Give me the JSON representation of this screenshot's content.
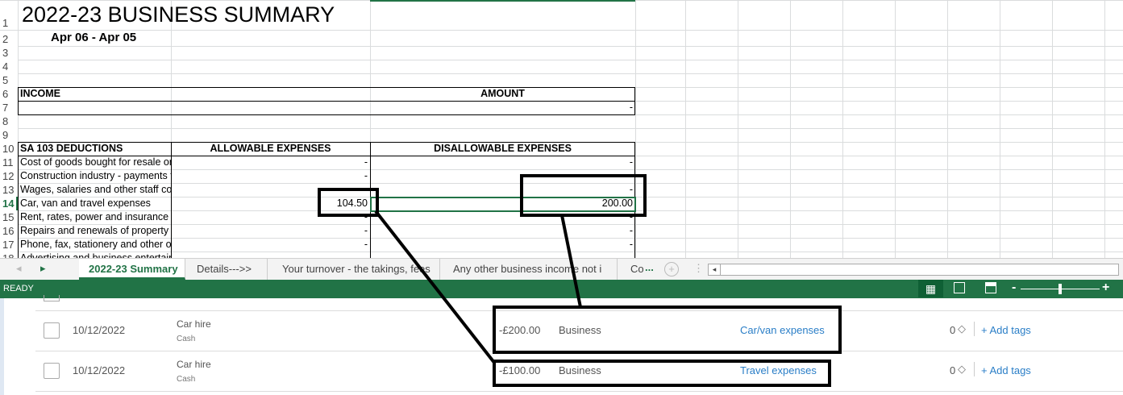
{
  "sheet": {
    "title": "2022-23 BUSINESS SUMMARY",
    "subtitle": "Apr 06 - Apr 05",
    "row_numbers": [
      "1",
      "2",
      "3",
      "4",
      "5",
      "6",
      "7",
      "8",
      "9",
      "10",
      "11",
      "12",
      "13",
      "14",
      "15",
      "16",
      "17",
      "18"
    ],
    "income_label": "INCOME",
    "amount_label": "AMOUNT",
    "row7_amount": "-",
    "deductions_label": "SA 103 DEDUCTIONS",
    "allowable_label": "ALLOWABLE EXPENSES",
    "disallowable_label": "DISALLOWABLE EXPENSES",
    "items": [
      {
        "label": "Cost of goods bought for resale or goods used",
        "allowable": "-",
        "disallowable": "-"
      },
      {
        "label": "Construction industry - payments to subcontractors",
        "allowable": "-",
        "disallowable": "-"
      },
      {
        "label": "Wages, salaries and other staff costs",
        "allowable": "-",
        "disallowable": "-"
      },
      {
        "label": "Car, van and travel expenses",
        "allowable": "104.50",
        "disallowable": "200.00"
      },
      {
        "label": "Rent, rates, power and insurance costs",
        "allowable": "-",
        "disallowable": "-"
      },
      {
        "label": "Repairs and renewals of property and equipment",
        "allowable": "-",
        "disallowable": "-"
      },
      {
        "label": "Phone, fax, stationery and other office costs",
        "allowable": "-",
        "disallowable": "-"
      },
      {
        "label": "Advertising and business entertainment costs",
        "allowable": "",
        "disallowable": ""
      }
    ]
  },
  "tabs": {
    "items": [
      "2022-23 Summary",
      "Details--->>",
      "Your turnover - the takings, fees",
      "Any other business income not i",
      "Co"
    ],
    "more": "...",
    "active": 0
  },
  "status": {
    "text": "READY"
  },
  "transactions": [
    {
      "date": "10/12/2022",
      "payee": "Car hire",
      "account": "Cash",
      "amount": "-£200.00",
      "type": "Business",
      "category": "Car/van expenses",
      "tag_count": "0",
      "add_tags": "+ Add tags"
    },
    {
      "date": "10/12/2022",
      "payee": "Car hire",
      "account": "Cash",
      "amount": "-£100.00",
      "type": "Business",
      "category": "Travel expenses",
      "tag_count": "0",
      "add_tags": "+ Add tags"
    }
  ],
  "colors": {
    "excel_green": "#217346",
    "link": "#2a7ec7"
  }
}
